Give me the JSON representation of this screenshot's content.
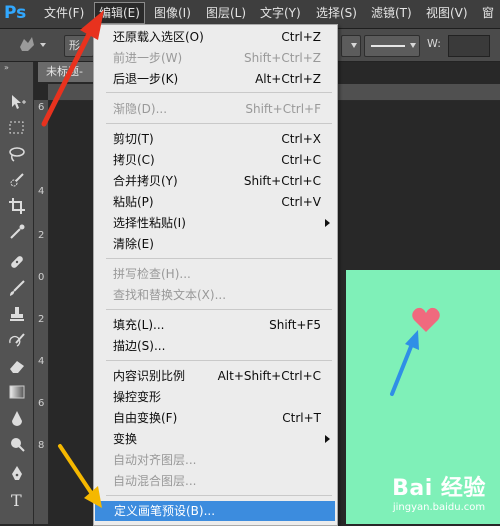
{
  "app": {
    "logo": "Ps"
  },
  "menubar": {
    "items": [
      {
        "label": "文件(F)"
      },
      {
        "label": "编辑(E)"
      },
      {
        "label": "图像(I)"
      },
      {
        "label": "图层(L)"
      },
      {
        "label": "文字(Y)"
      },
      {
        "label": "选择(S)"
      },
      {
        "label": "滤镜(T)"
      },
      {
        "label": "视图(V)"
      },
      {
        "label": "窗"
      }
    ]
  },
  "options": {
    "shape_mode": "形",
    "width_label": "W:"
  },
  "document": {
    "tab_title": "未标题-"
  },
  "rulers": {
    "left_numbers": [
      "6",
      "4",
      "2",
      "0",
      "2",
      "4",
      "6",
      "8"
    ]
  },
  "edit_menu": {
    "items": [
      {
        "label": "还原载入选区(O)",
        "shortcut": "Ctrl+Z",
        "disabled": false
      },
      {
        "label": "前进一步(W)",
        "shortcut": "Shift+Ctrl+Z",
        "disabled": true
      },
      {
        "label": "后退一步(K)",
        "shortcut": "Alt+Ctrl+Z",
        "disabled": false
      },
      {
        "label": "渐隐(D)...",
        "shortcut": "Shift+Ctrl+F",
        "disabled": true
      },
      {
        "label": "剪切(T)",
        "shortcut": "Ctrl+X",
        "disabled": false
      },
      {
        "label": "拷贝(C)",
        "shortcut": "Ctrl+C",
        "disabled": false
      },
      {
        "label": "合并拷贝(Y)",
        "shortcut": "Shift+Ctrl+C",
        "disabled": false
      },
      {
        "label": "粘贴(P)",
        "shortcut": "Ctrl+V",
        "disabled": false
      },
      {
        "label": "选择性粘贴(I)",
        "shortcut": "",
        "disabled": false,
        "submenu": true
      },
      {
        "label": "清除(E)",
        "shortcut": "",
        "disabled": false
      },
      {
        "label": "拼写检查(H)...",
        "shortcut": "",
        "disabled": true
      },
      {
        "label": "查找和替换文本(X)...",
        "shortcut": "",
        "disabled": true
      },
      {
        "label": "填充(L)...",
        "shortcut": "Shift+F5",
        "disabled": false
      },
      {
        "label": "描边(S)...",
        "shortcut": "",
        "disabled": false
      },
      {
        "label": "内容识别比例",
        "shortcut": "Alt+Shift+Ctrl+C",
        "disabled": false
      },
      {
        "label": "操控变形",
        "shortcut": "",
        "disabled": false
      },
      {
        "label": "自由变换(F)",
        "shortcut": "Ctrl+T",
        "disabled": false
      },
      {
        "label": "变换",
        "shortcut": "",
        "disabled": false,
        "submenu": true
      },
      {
        "label": "自动对齐图层...",
        "shortcut": "",
        "disabled": true
      },
      {
        "label": "自动混合图层...",
        "shortcut": "",
        "disabled": true
      },
      {
        "label": "定义画笔预设(B)...",
        "shortcut": "",
        "disabled": false,
        "highlighted": true
      }
    ]
  },
  "canvas": {
    "background_color": "#7ff0b8",
    "heart_color": "#f06a7e"
  },
  "annotations": {
    "arrow_colors": [
      "#e8321e",
      "#f5b800",
      "#2f8fe6"
    ]
  },
  "watermark": {
    "logo": "Bai 经验",
    "url": "jingyan.baidu.com"
  },
  "colors": {
    "menu_highlight": "#3c8cde",
    "ps_blue": "#31a8ff"
  }
}
